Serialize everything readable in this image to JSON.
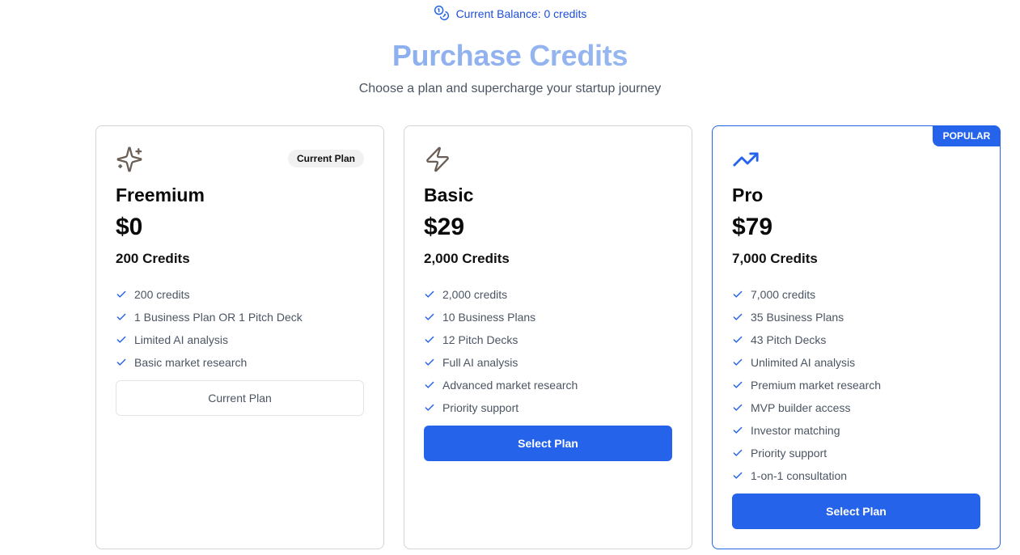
{
  "balance": {
    "icon": "coins-icon",
    "text": "Current Balance: 0 credits"
  },
  "header": {
    "title": "Purchase Credits",
    "subtitle": "Choose a plan and supercharge your startup journey"
  },
  "colors": {
    "accent": "#2563eb",
    "title_gradient_start": "#7fa4ec",
    "title_gradient_end": "#a5c2f2"
  },
  "plans": [
    {
      "icon": "sparkles-icon",
      "badge": "Current Plan",
      "name": "Freemium",
      "price": "$0",
      "credits": "200 Credits",
      "features": [
        "200 credits",
        "1 Business Plan OR 1 Pitch Deck",
        "Limited AI analysis",
        "Basic market research"
      ],
      "button": "Current Plan"
    },
    {
      "icon": "zap-icon",
      "name": "Basic",
      "price": "$29",
      "credits": "2,000 Credits",
      "features": [
        "2,000 credits",
        "10 Business Plans",
        "12 Pitch Decks",
        "Full AI analysis",
        "Advanced market research",
        "Priority support"
      ],
      "button": "Select Plan"
    },
    {
      "icon": "trending-up-icon",
      "badge": "POPULAR",
      "name": "Pro",
      "price": "$79",
      "credits": "7,000 Credits",
      "features": [
        "7,000 credits",
        "35 Business Plans",
        "43 Pitch Decks",
        "Unlimited AI analysis",
        "Premium market research",
        "MVP builder access",
        "Investor matching",
        "Priority support",
        "1-on-1 consultation"
      ],
      "button": "Select Plan"
    }
  ]
}
